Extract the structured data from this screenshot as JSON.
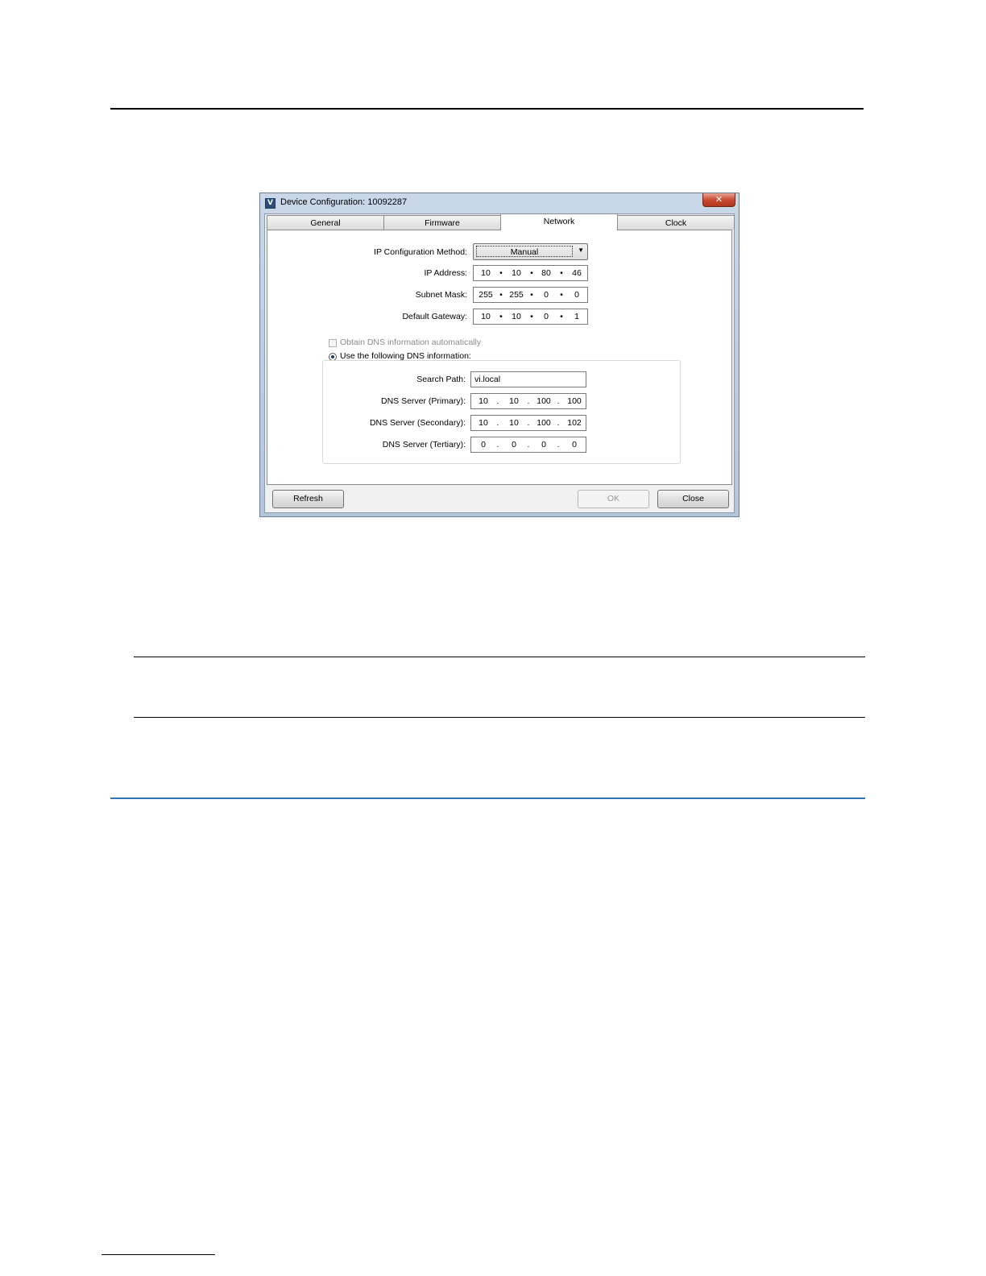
{
  "window": {
    "title": "Device Configuration: 10092287",
    "close_glyph": "✕"
  },
  "tabs": [
    {
      "label": "General"
    },
    {
      "label": "Firmware"
    },
    {
      "label": "Network"
    },
    {
      "label": "Clock"
    }
  ],
  "active_tab": "Network",
  "network": {
    "ip_method_label": "IP Configuration Method:",
    "ip_method_value": "Manual",
    "ip_address_label": "IP Address:",
    "ip_address": [
      "10",
      "10",
      "80",
      "46"
    ],
    "subnet_label": "Subnet Mask:",
    "subnet": [
      "255",
      "255",
      "0",
      "0"
    ],
    "gateway_label": "Default Gateway:",
    "gateway": [
      "10",
      "10",
      "0",
      "1"
    ]
  },
  "dns": {
    "auto_label": "Obtain DNS information automatically",
    "auto_checked": false,
    "manual_label": "Use the following DNS information:",
    "manual_selected": true,
    "search_path_label": "Search Path:",
    "search_path": "vi.local",
    "primary_label": "DNS Server (Primary):",
    "primary": [
      "10",
      "10",
      "100",
      "100"
    ],
    "secondary_label": "DNS Server (Secondary):",
    "secondary": [
      "10",
      "10",
      "100",
      "102"
    ],
    "tertiary_label": "DNS Server (Tertiary):",
    "tertiary": [
      "0",
      "0",
      "0",
      "0"
    ]
  },
  "buttons": {
    "refresh": "Refresh",
    "ok": "OK",
    "close": "Close"
  },
  "icons": {
    "app": "app-icon",
    "dropdown": "chevron-down-icon"
  }
}
